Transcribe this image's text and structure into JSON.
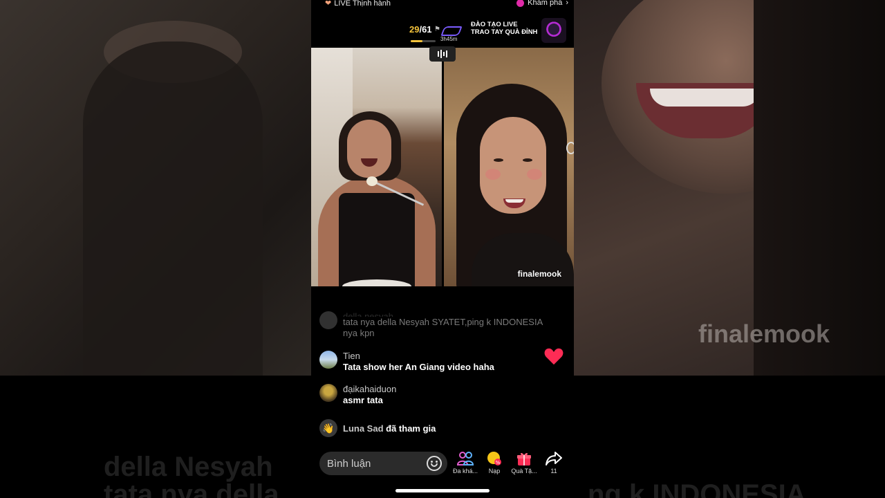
{
  "header": {
    "live_trending": "LIVE Thịnh hành",
    "explore": "Khám phá",
    "chevron": "›",
    "score_current": "29",
    "score_total": "/61",
    "score_progress": 0.48,
    "timer": "3h45m",
    "promo_line1": "ĐÀO TẠO LIVE",
    "promo_line2": "TRAO TAY QUÀ ĐỈNH"
  },
  "video": {
    "right_username": "finalemook"
  },
  "background": {
    "right_name": "finalemook",
    "left_line1": "della Nesyah",
    "left_line2": "tata nya della",
    "right_line2": "ng k INDONESIA"
  },
  "comments": [
    {
      "name": "della nesyah",
      "text": "tata nya della Nesyah SYATET,ping k INDONESIA nya kpn"
    },
    {
      "name": "Tien",
      "text": "Tata show her An Giang video haha"
    },
    {
      "name": "đạikahaiduon",
      "text": "asmr tata"
    }
  ],
  "join_notice": {
    "name": "Luna Sad",
    "text": "đã tham gia"
  },
  "bottom_bar": {
    "comment_placeholder": "Bình luận",
    "actions": [
      {
        "label": "Đa khá...",
        "icon": "multi-guest-icon"
      },
      {
        "label": "Nạp",
        "icon": "coin-recharge-icon"
      },
      {
        "label": "Quà Tặ...",
        "icon": "gift-icon"
      },
      {
        "label": "11",
        "icon": "share-icon"
      }
    ]
  },
  "colors": {
    "accent_heart": "#fe2c55",
    "score_yellow": "#f3c23b",
    "promo_purple": "#7b5cff"
  }
}
